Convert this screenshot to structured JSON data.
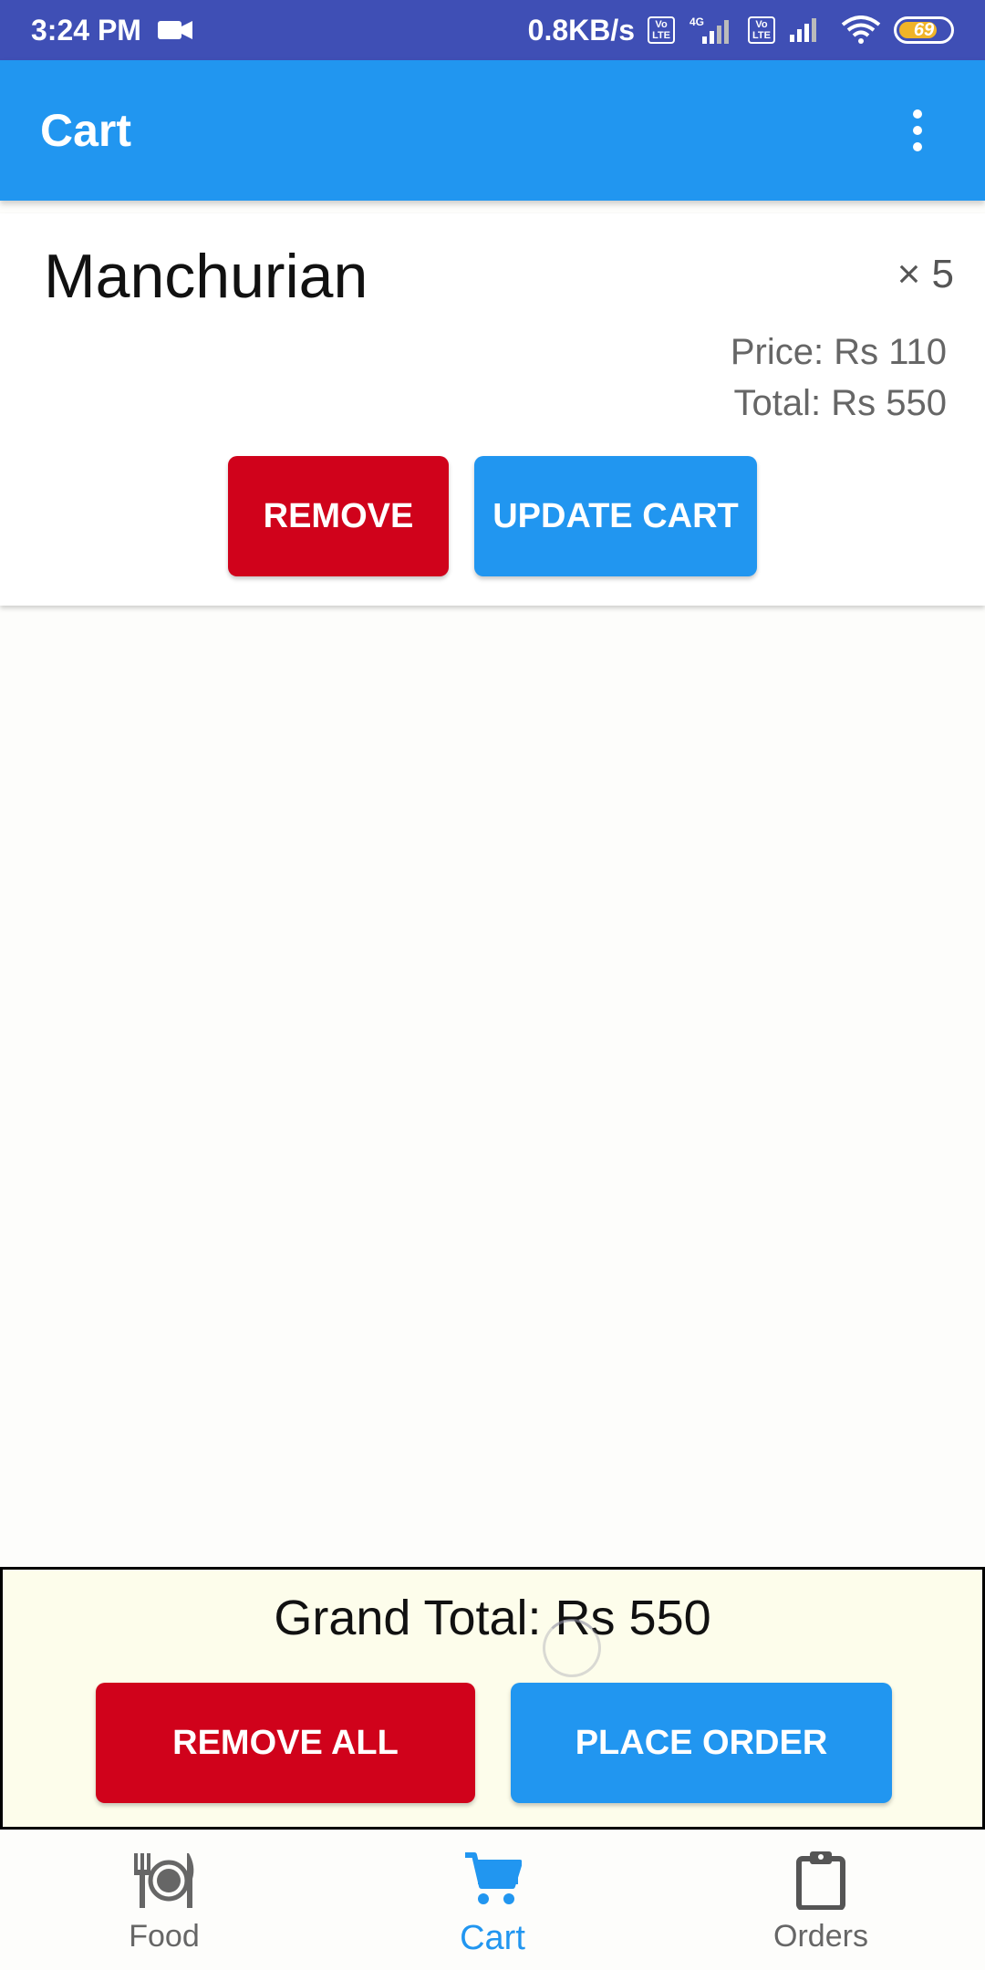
{
  "status_bar": {
    "time": "3:24 PM",
    "net_speed": "0.8KB/s",
    "lte_badge": "Vo\nLTE",
    "network_4g": "4G",
    "battery": "69",
    "icons": [
      "video-camera-icon",
      "volte-icon",
      "signal-icon",
      "wifi-icon",
      "battery-icon"
    ]
  },
  "app_bar": {
    "title": "Cart",
    "menu_icon": "overflow-menu-icon"
  },
  "cart": {
    "items": [
      {
        "name": "Manchurian",
        "quantity": "× 5",
        "price": "Price: Rs 110",
        "total": "Total: Rs 550",
        "remove_label": "REMOVE",
        "update_label": "UPDATE CART"
      }
    ]
  },
  "summary": {
    "grand_total": "Grand Total: Rs 550",
    "remove_all_label": "REMOVE ALL",
    "place_order_label": "PLACE ORDER"
  },
  "bottom_nav": {
    "items": [
      {
        "label": "Food",
        "icon": "plate-cutlery-icon",
        "active": false
      },
      {
        "label": "Cart",
        "icon": "cart-icon",
        "active": true
      },
      {
        "label": "Orders",
        "icon": "clipboard-icon",
        "active": false
      }
    ]
  },
  "colors": {
    "status_bar": "#3f4fb5",
    "primary": "#2196f0",
    "danger": "#d0021b",
    "summary_bg": "#fdfdeb"
  }
}
